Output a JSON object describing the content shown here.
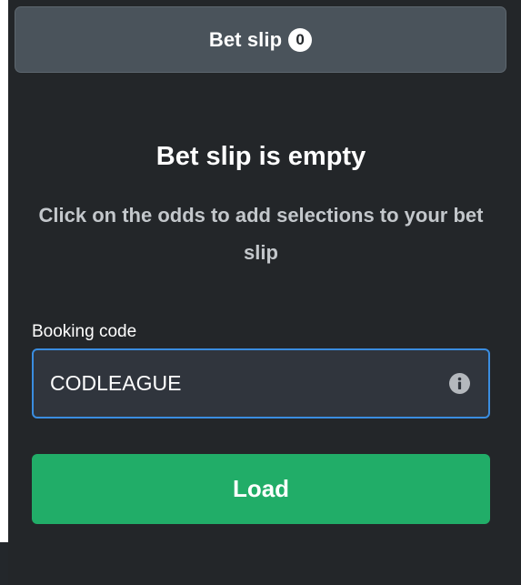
{
  "header": {
    "title": "Bet slip",
    "count": "0"
  },
  "empty_state": {
    "title": "Bet slip is empty",
    "description": "Click on the odds to add selections to your bet slip"
  },
  "booking": {
    "label": "Booking code",
    "value": "CODLEAGUE",
    "info_icon": "info-icon"
  },
  "actions": {
    "load_label": "Load"
  },
  "colors": {
    "panel_bg": "#232629",
    "header_bg": "#4a535b",
    "input_border": "#3a8de0",
    "load_button": "#21ad68"
  }
}
